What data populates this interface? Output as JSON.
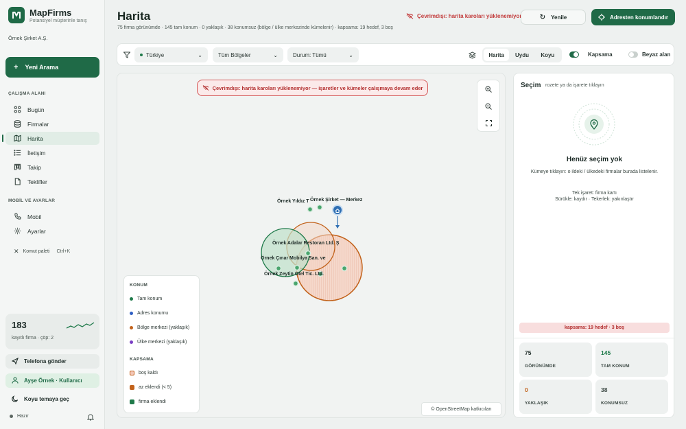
{
  "app": {
    "name": "MapFirms",
    "tagline": "Potansiyel müşterinle tanış",
    "org": "Örnek Şirket A.Ş."
  },
  "sidebar": {
    "new_search": "Yeni Arama",
    "workspace_title": "ÇALIŞMA ALANI",
    "items": [
      {
        "label": "Bugün",
        "icon": "grid-icon"
      },
      {
        "label": "Firmalar",
        "icon": "database-icon"
      },
      {
        "label": "Harita",
        "icon": "map-icon"
      },
      {
        "label": "İletişim",
        "icon": "list-icon"
      },
      {
        "label": "Takip",
        "icon": "kanban-icon"
      },
      {
        "label": "Teklifler",
        "icon": "document-icon"
      }
    ],
    "mobile_title": "MOBİL VE AYARLAR",
    "mobile_items": [
      {
        "label": "Mobil",
        "icon": "phone-icon"
      },
      {
        "label": "Ayarlar",
        "icon": "gear-icon"
      }
    ],
    "command_palette": "Komut paleti",
    "command_shortcut": "Ctrl+K",
    "stat": {
      "value": "183",
      "label": "kayıtlı firma · çöp: 2"
    },
    "send_phone": "Telefona gönder",
    "user": "Ayşe Örnek · Kullanıcı",
    "dark_mode": "Koyu temaya geç",
    "status": "Hazır"
  },
  "header": {
    "title": "Harita",
    "subtitle": "75 firma görünümde · 145 tam konum · 0 yaklaşık · 38 konumsuz (bölge / ülke merkezinde kümelenir) · kapsama: 19 hedef, 3 boş",
    "offline": "Çevrimdışı: harita karoları yüklenemiyor",
    "refresh": "Yenile",
    "locate": "Adresten konumlandır"
  },
  "filters": {
    "country": "Türkiye",
    "region": "Tüm Bölgeler",
    "status": "Durum: Tümü",
    "basemaps": [
      "Harita",
      "Uydu",
      "Koyu"
    ],
    "active_basemap": "Harita",
    "coverage_label": "Kapsama",
    "whitespace_label": "Beyaz alan"
  },
  "map": {
    "alert": "Çevrimdışı: harita karoları yüklenemiyor — işaretler ve kümeler çalışmaya devam eder",
    "labels": {
      "yildiz": "Örnek Yıldız T",
      "merkez": "Örnek Şirket — Merkez",
      "adalar": "Örnek Adalar Restoran Ltd. Ş",
      "cinar": "Örnek Çınar Mobilya San. ve",
      "zeytin": "Örnek Zeytin Otel Tic. Ltd."
    },
    "attribution": "© OpenStreetMap katkıcıları",
    "legend": {
      "location_title": "KONUM",
      "location_items": [
        {
          "label": "Tam konum",
          "color": "#1f7a4a"
        },
        {
          "label": "Adres konumu",
          "color": "#2f5fc4"
        },
        {
          "label": "Bölge merkezi (yaklaşık)",
          "color": "#c2621b"
        },
        {
          "label": "Ülke merkezi (yaklaşık)",
          "color": "#7a3fc4"
        }
      ],
      "coverage_title": "KAPSAMA",
      "coverage_items": [
        {
          "label": "boş kaldı",
          "color": "#f3c7b8"
        },
        {
          "label": "az eklendi (< 5)",
          "color": "#c2621b"
        },
        {
          "label": "firma eklendi",
          "color": "#1f7a4a"
        }
      ]
    }
  },
  "panel": {
    "title": "Seçim",
    "hint": "rozete ya da işarete tıklayın",
    "empty_title": "Henüz seçim yok",
    "empty_text1": "Kümeye tıklayın: o ildeki / ülkedeki firmalar burada listelenir.",
    "empty_text2": "Tek işaret: firma kartı",
    "empty_text3": "Sürükle: kaydır · Tekerlek: yakınlaştır",
    "coverage": "kapsama: 19 hedef · 3 boş",
    "kpis": [
      {
        "value": "75",
        "label": "GÖRÜNÜMDE",
        "color": "#1d2b27"
      },
      {
        "value": "145",
        "label": "TAM KONUM",
        "color": "#1f7a4a"
      },
      {
        "value": "0",
        "label": "YAKLAŞIK",
        "color": "#c2621b"
      },
      {
        "value": "38",
        "label": "KONUMSUZ",
        "color": "#3d4a45"
      }
    ]
  }
}
